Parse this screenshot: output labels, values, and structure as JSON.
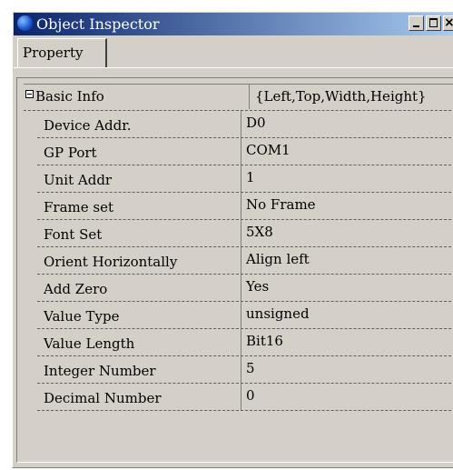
{
  "window": {
    "title": "Object Inspector"
  },
  "tabs": [
    {
      "label": "Property"
    }
  ],
  "header_row": {
    "label": "Basic Info",
    "value": "{Left,Top,Width,Height}"
  },
  "properties": [
    {
      "label": "Device Addr.",
      "value": "D0"
    },
    {
      "label": "GP Port",
      "value": "COM1"
    },
    {
      "label": "Unit Addr",
      "value": "1"
    },
    {
      "label": "Frame set",
      "value": "No Frame"
    },
    {
      "label": "Font Set",
      "value": "5X8"
    },
    {
      "label": "Orient Horizontally",
      "value": "Align left"
    },
    {
      "label": "Add Zero",
      "value": "Yes"
    },
    {
      "label": "Value Type",
      "value": "unsigned"
    },
    {
      "label": "Value Length",
      "value": "Bit16"
    },
    {
      "label": "Integer Number",
      "value": "5"
    },
    {
      "label": "Decimal Number",
      "value": "0"
    }
  ],
  "icons": {
    "app": "object-inspector-globe-icon",
    "minimize": "minimize-icon",
    "maximize": "maximize-icon",
    "close": "close-icon",
    "expand": "collapse-box-icon"
  },
  "colors": {
    "titlebar_start": "#0a246a",
    "titlebar_end": "#a6caf0",
    "face": "#d4d0c8"
  }
}
